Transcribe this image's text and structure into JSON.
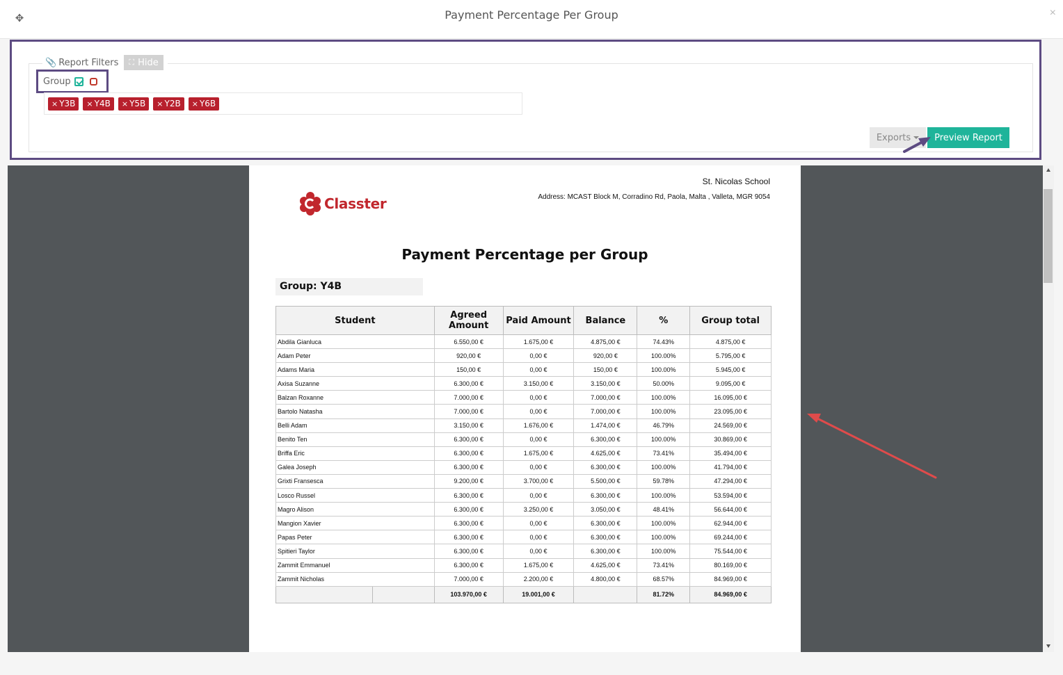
{
  "modal": {
    "title": "Payment Percentage Per Group",
    "close": "×",
    "move": "✥"
  },
  "filters": {
    "legend": "Report Filters",
    "hide_label": "Hide",
    "group_label": "Group",
    "tags": [
      "Y3B",
      "Y4B",
      "Y5B",
      "Y2B",
      "Y6B"
    ],
    "exports_label": "Exports",
    "preview_label": "Preview Report"
  },
  "report": {
    "school_name": "St. Nicolas School",
    "address": "Address: MCAST Block M, Corradino Rd, Paola, Malta , Valleta, MGR 9054",
    "logo_text": "Classter",
    "title": "Payment Percentage per Group",
    "group_heading": "Group: Y4B",
    "columns": {
      "student": "Student",
      "agreed": "Agreed Amount",
      "paid": "Paid Amount",
      "balance": "Balance",
      "percent": "%",
      "group_total": "Group total"
    },
    "rows": [
      [
        "Abdila Gianluca",
        "6.550,00 €",
        "1.675,00 €",
        "4.875,00 €",
        "74.43%",
        "4.875,00 €"
      ],
      [
        "Adam Peter",
        "920,00 €",
        "0,00 €",
        "920,00 €",
        "100.00%",
        "5.795,00 €"
      ],
      [
        "Adams Maria",
        "150,00 €",
        "0,00 €",
        "150,00 €",
        "100.00%",
        "5.945,00 €"
      ],
      [
        "Axisa Suzanne",
        "6.300,00 €",
        "3.150,00 €",
        "3.150,00 €",
        "50.00%",
        "9.095,00 €"
      ],
      [
        "Balzan Roxanne",
        "7.000,00 €",
        "0,00 €",
        "7.000,00 €",
        "100.00%",
        "16.095,00 €"
      ],
      [
        "Bartolo Natasha",
        "7.000,00 €",
        "0,00 €",
        "7.000,00 €",
        "100.00%",
        "23.095,00 €"
      ],
      [
        "Belli Adam",
        "3.150,00 €",
        "1.676,00 €",
        "1.474,00 €",
        "46.79%",
        "24.569,00 €"
      ],
      [
        "Benito Ten",
        "6.300,00 €",
        "0,00 €",
        "6.300,00 €",
        "100.00%",
        "30.869,00 €"
      ],
      [
        "Briffa Eric",
        "6.300,00 €",
        "1.675,00 €",
        "4.625,00 €",
        "73.41%",
        "35.494,00 €"
      ],
      [
        "Galea Joseph",
        "6.300,00 €",
        "0,00 €",
        "6.300,00 €",
        "100.00%",
        "41.794,00 €"
      ],
      [
        "Grixti Fransesca",
        "9.200,00 €",
        "3.700,00 €",
        "5.500,00 €",
        "59.78%",
        "47.294,00 €"
      ],
      [
        "Losco Russel",
        "6.300,00 €",
        "0,00 €",
        "6.300,00 €",
        "100.00%",
        "53.594,00 €"
      ],
      [
        "Magro Alison",
        "6.300,00 €",
        "3.250,00 €",
        "3.050,00 €",
        "48.41%",
        "56.644,00 €"
      ],
      [
        "Mangion Xavier",
        "6.300,00 €",
        "0,00 €",
        "6.300,00 €",
        "100.00%",
        "62.944,00 €"
      ],
      [
        "Papas Peter",
        "6.300,00 €",
        "0,00 €",
        "6.300,00 €",
        "100.00%",
        "69.244,00 €"
      ],
      [
        "Spitieri Taylor",
        "6.300,00 €",
        "0,00 €",
        "6.300,00 €",
        "100.00%",
        "75.544,00 €"
      ],
      [
        "Zammit Emmanuel",
        "6.300,00 €",
        "1.675,00 €",
        "4.625,00 €",
        "73.41%",
        "80.169,00 €"
      ],
      [
        "Zammit Nicholas",
        "7.000,00 €",
        "2.200,00 €",
        "4.800,00 €",
        "68.57%",
        "84.969,00 €"
      ]
    ],
    "totals": {
      "agreed": "103.970,00 €",
      "paid": "19.001,00 €",
      "percent": "81.72%",
      "group_total": "84.969,00 €"
    }
  },
  "colors": {
    "accent": "#1fb49a",
    "highlight_box": "#5d4b82",
    "tag": "#b8202d",
    "brand": "#c1272d",
    "arrow": "#e04b4b"
  }
}
